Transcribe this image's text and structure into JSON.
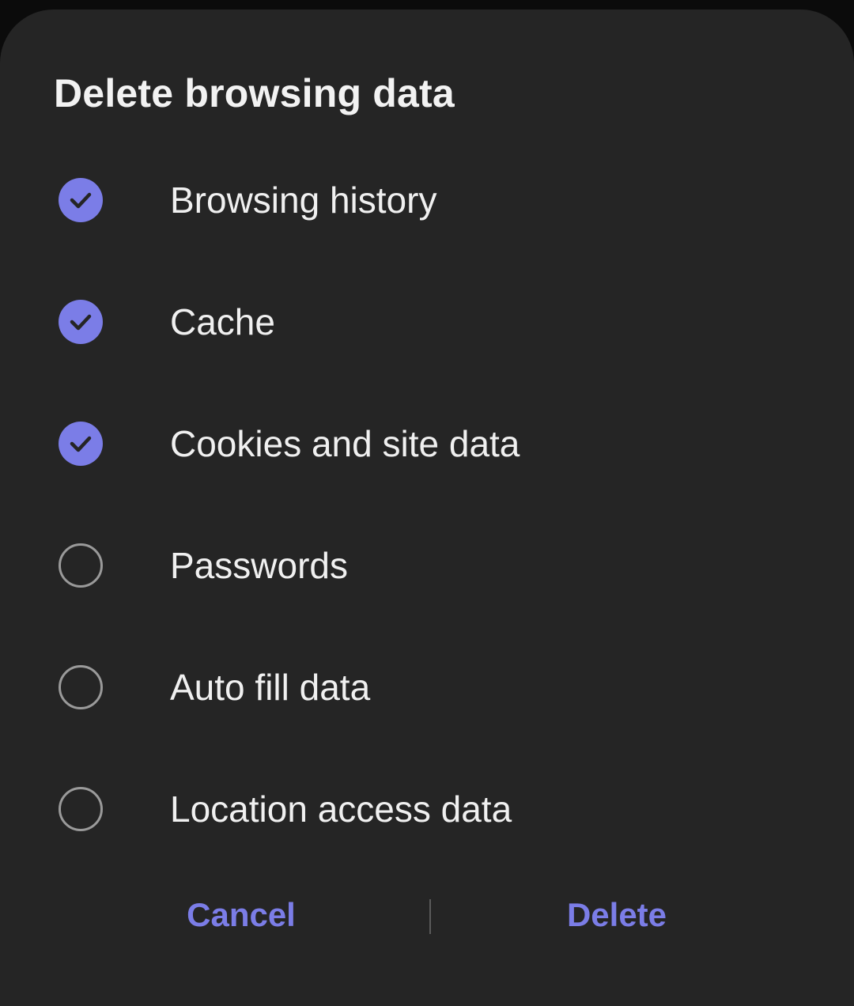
{
  "dialog": {
    "title": "Delete browsing data",
    "accent_color": "#7b7de7",
    "options": [
      {
        "label": "Browsing history",
        "checked": true
      },
      {
        "label": "Cache",
        "checked": true
      },
      {
        "label": "Cookies and site data",
        "checked": true
      },
      {
        "label": "Passwords",
        "checked": false
      },
      {
        "label": "Auto fill data",
        "checked": false
      },
      {
        "label": "Location access data",
        "checked": false
      }
    ],
    "cancel_label": "Cancel",
    "delete_label": "Delete"
  }
}
